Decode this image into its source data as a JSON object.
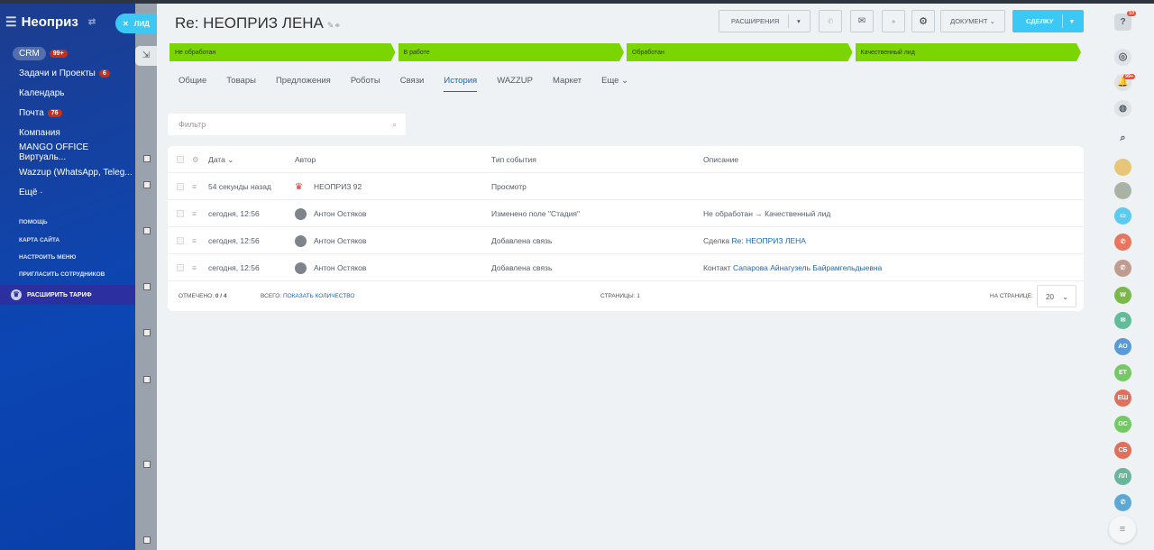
{
  "sidebar": {
    "logo": "Неоприз",
    "crm": "CRM",
    "crm_badge": "99+",
    "items": [
      {
        "label": "Задачи и Проекты",
        "badge": "6"
      },
      {
        "label": "Календарь"
      },
      {
        "label": "Почта",
        "badge": "76"
      },
      {
        "label": "Компания"
      },
      {
        "label": "MANGO OFFICE Виртуаль..."
      },
      {
        "label": "Wazzup (WhatsApp, Teleg..."
      },
      {
        "label": "Ещё ·"
      }
    ],
    "links": [
      "ПОМОЩЬ",
      "КАРТА САЙТА",
      "НАСТРОИТЬ МЕНЮ",
      "ПРИГЛАСИТЬ СОТРУДНИКОВ"
    ],
    "tarif": "РАСШИРИТЬ ТАРИФ"
  },
  "slider_tab": "ЛИД",
  "header": {
    "title": "Re: НЕОПРИЗ ЛЕНА",
    "extensions": "РАСШИРЕНИЯ",
    "document": "ДОКУМЕНТ",
    "create": "СДЕЛКУ"
  },
  "stages": [
    "Не обработан",
    "В работе",
    "Обработан",
    "Качественный лид"
  ],
  "stage_color": "#7bd500",
  "tabs": [
    "Общие",
    "Товары",
    "Предложения",
    "Роботы",
    "Связи",
    "История",
    "WAZZUP",
    "Маркет",
    "Еще"
  ],
  "filter_placeholder": "Фильтр",
  "table": {
    "headers": [
      "Дата",
      "Автор",
      "Тип события",
      "Описание"
    ],
    "rows": [
      {
        "date": "54 секунды назад",
        "author": "НЕОПРИЗ 92",
        "type": "Просмотр",
        "desc": "",
        "link": ""
      },
      {
        "date": "сегодня, 12:56",
        "author": "Антон Остяков",
        "type": "Изменено поле \"Стадия\"",
        "desc": "Не обработан → Качественный лид",
        "link": ""
      },
      {
        "date": "сегодня, 12:56",
        "author": "Антон Остяков",
        "type": "Добавлена связь",
        "desc": "Сделка",
        "link": "Re: НЕОПРИЗ ЛЕНА"
      },
      {
        "date": "сегодня, 12:56",
        "author": "Антон Остяков",
        "type": "Добавлена связь",
        "desc": "Контакт",
        "link": "Сапарова Айнагузель Байрамгельдыевна"
      }
    ],
    "footer": {
      "checked_label": "ОТМЕЧЕНО:",
      "checked": "0 / 4",
      "total_label": "ВСЕГО:",
      "total_link": "ПОКАЗАТЬ КОЛИЧЕСТВО",
      "pages": "СТРАНИЦЫ: 1",
      "per_page_label": "НА СТРАНИЦЕ:",
      "per_page": "20"
    }
  },
  "right": {
    "help_badge": "10",
    "bell_badge": "99+",
    "avatars": [
      "W",
      "АО",
      "ЕТ",
      "ЕШ",
      "ОС",
      "СБ",
      "ЛЛ"
    ]
  }
}
